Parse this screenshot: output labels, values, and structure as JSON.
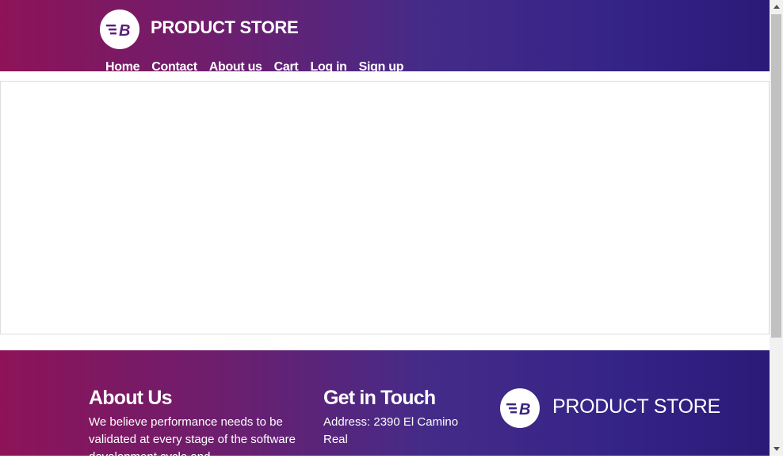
{
  "header": {
    "brand": "PRODUCT STORE",
    "logo_letter": "B",
    "nav": [
      "Home",
      "Contact",
      "About us",
      "Cart",
      "Log in",
      "Sign up"
    ]
  },
  "footer": {
    "about_title": "About Us",
    "about_text": "We believe performance needs to be validated at every stage of the software development cycle and",
    "contact_title": "Get in Touch",
    "contact_address": "Address: 2390 El Camino Real",
    "brand": "PRODUCT STORE",
    "logo_letter": "B"
  },
  "colors": {
    "gradient_start": "#8e1358",
    "gradient_end": "#2c1a78",
    "logo_mark": "#5b1f7a"
  },
  "icons": {
    "logo": "lightning-b-logo",
    "scroll_up": "triangle-up",
    "scroll_down": "triangle-down"
  }
}
